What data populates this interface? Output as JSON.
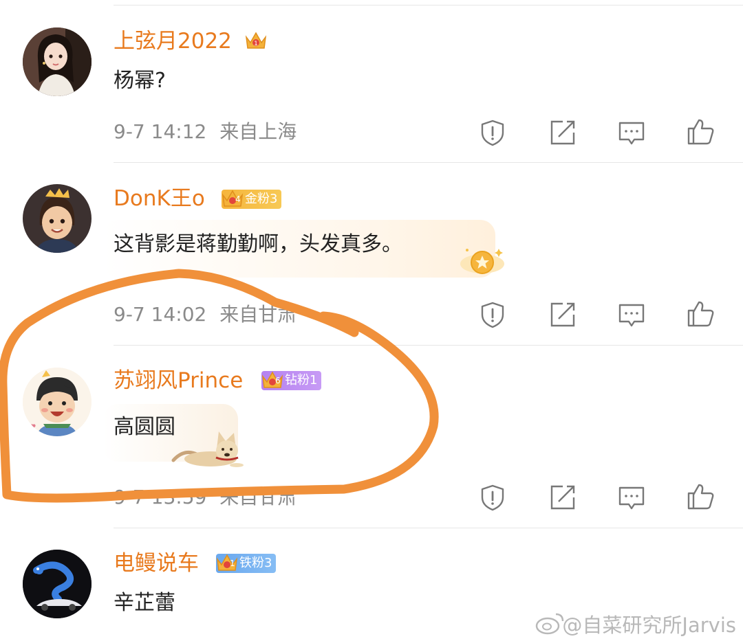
{
  "comments": [
    {
      "username": "上弦月2022",
      "text": "杨幂?",
      "time": "9-7 14:12",
      "location": "来自上海",
      "avatar_icon": "avatar-girl-icon",
      "badge": null
    },
    {
      "username": "DonK王o",
      "text": "这背影是蒋勤勤啊，头发真多。",
      "time": "9-7 14:02",
      "location": "来自甘肃",
      "avatar_icon": "avatar-boy-crown-icon",
      "badge": {
        "label": "金粉3",
        "level": "4",
        "color": "#f6b53c"
      }
    },
    {
      "username": "苏翊风Prince",
      "text": "高圆圆",
      "time": "9-7 13:59",
      "location": "来自甘肃",
      "avatar_icon": "avatar-cartoon-boy-icon",
      "badge": {
        "label": "钻粉1",
        "level": "6",
        "color": "#b582f0"
      }
    },
    {
      "username": "电鳗说车",
      "text": "辛芷蕾",
      "time": "",
      "location": "",
      "avatar_icon": "avatar-eel-car-icon",
      "badge": {
        "label": "铁粉3",
        "level": "1",
        "color": "#6aa8ee"
      }
    }
  ],
  "actions": [
    "report-icon",
    "share-icon",
    "reply-icon",
    "like-icon"
  ],
  "watermark": "@自菜研究所Jarvis",
  "colors": {
    "username": "#e87a1e",
    "meta": "#8a8a8a",
    "annotation": "#f0903a"
  }
}
